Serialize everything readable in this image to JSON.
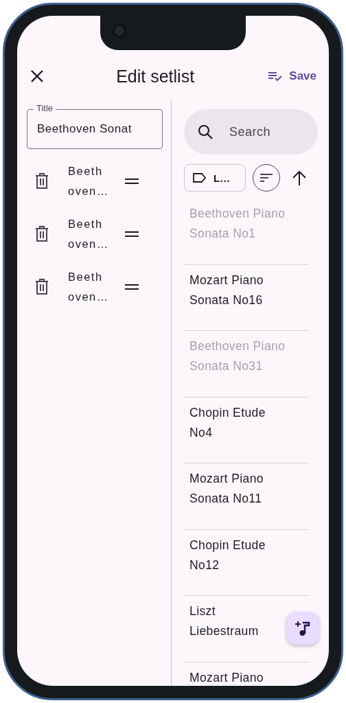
{
  "header": {
    "title": "Edit setlist",
    "save_label": "Save"
  },
  "title_field": {
    "label": "Title",
    "value": "Beethoven Sonat"
  },
  "setlist": [
    {
      "name": "Beethoven…"
    },
    {
      "name": "Beethoven…"
    },
    {
      "name": "Beethoven…"
    }
  ],
  "library": {
    "search": {
      "placeholder": "Search"
    },
    "filter_chip": {
      "label": "L…"
    },
    "songs": [
      {
        "name": "Beethoven Piano Sonata No1",
        "disabled": true
      },
      {
        "name": "Mozart Piano Sonata No16",
        "disabled": false
      },
      {
        "name": "Beethoven Piano Sonata No31",
        "disabled": true
      },
      {
        "name": "Chopin Etude No4",
        "disabled": false
      },
      {
        "name": "Mozart Piano Sonata No11",
        "disabled": false
      },
      {
        "name": "Chopin Etude No12",
        "disabled": false
      },
      {
        "name": "Liszt Liebestraum",
        "disabled": false
      },
      {
        "name": "Mozart Piano",
        "disabled": false
      }
    ]
  }
}
